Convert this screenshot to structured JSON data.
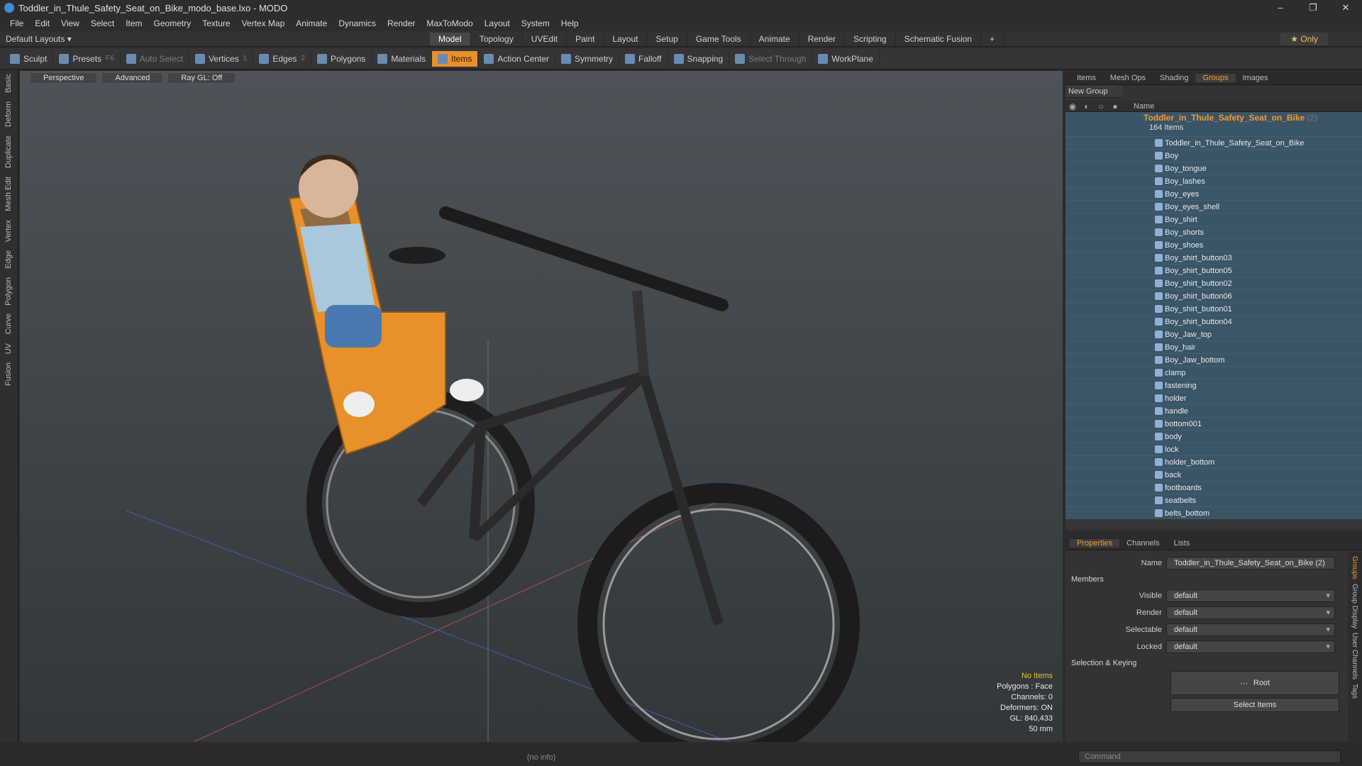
{
  "title": "Toddler_in_Thule_Safety_Seat_on_Bike_modo_base.lxo - MODO",
  "menu": [
    "File",
    "Edit",
    "View",
    "Select",
    "Item",
    "Geometry",
    "Texture",
    "Vertex Map",
    "Animate",
    "Dynamics",
    "Render",
    "MaxToModo",
    "Layout",
    "System",
    "Help"
  ],
  "layout_label": "Default Layouts ▾",
  "layout_tabs": [
    "Model",
    "Topology",
    "UVEdit",
    "Paint",
    "Layout",
    "Setup",
    "Game Tools",
    "Animate",
    "Render",
    "Scripting",
    "Schematic Fusion"
  ],
  "only_label": "★ Only",
  "toolbar": {
    "sculpt": "Sculpt",
    "presets": "Presets",
    "presets_key": "F6",
    "auto_select": "Auto Select",
    "vertices": "Vertices",
    "vertices_n": "1",
    "edges": "Edges",
    "edges_n": "2",
    "polygons": "Polygons",
    "materials": "Materials",
    "items": "Items",
    "action_center": "Action Center",
    "symmetry": "Symmetry",
    "falloff": "Falloff",
    "snapping": "Snapping",
    "select_through": "Select Through",
    "workplane": "WorkPlane"
  },
  "left_tabs": [
    "Basic",
    "Deform",
    "Duplicate",
    "Mesh Edit",
    "Vertex",
    "Edge",
    "Polygon",
    "Curve",
    "UV",
    "Fusion"
  ],
  "viewport": {
    "buttons": [
      "Perspective",
      "Advanced",
      "Ray GL: Off"
    ],
    "info": {
      "warn": "No Items",
      "polygons": "Polygons : Face",
      "channels": "Channels: 0",
      "deformers": "Deformers: ON",
      "gl": "GL: 840,433",
      "lens": "50 mm"
    }
  },
  "status_text": "(no info)",
  "groups_panel": {
    "tabs": [
      "Items",
      "Mesh Ops",
      "Shading",
      "Groups",
      "Images"
    ],
    "new_group": "New Group",
    "col_name": "Name",
    "group_name": "Toddler_in_Thule_Safety_Seat_on_Bike",
    "group_count": "(2)",
    "group_sub": "164 Items",
    "items": [
      "Toddler_in_Thule_Safety_Seat_on_Bike",
      "Boy",
      "Boy_tongue",
      "Boy_lashes",
      "Boy_eyes",
      "Boy_eyes_shell",
      "Boy_shirt",
      "Boy_shorts",
      "Boy_shoes",
      "Boy_shirt_button03",
      "Boy_shirt_button05",
      "Boy_shirt_button02",
      "Boy_shirt_button06",
      "Boy_shirt_button01",
      "Boy_shirt_button04",
      "Boy_Jaw_top",
      "Boy_hair",
      "Boy_Jaw_bottom",
      "clamp",
      "fastening",
      "holder",
      "handle",
      "bottom001",
      "body",
      "lock",
      "holder_bottom",
      "back",
      "footboards",
      "seatbelts",
      "belts_bottom"
    ]
  },
  "props": {
    "tabs": [
      "Properties",
      "Channels",
      "Lists"
    ],
    "name_label": "Name",
    "name_value": "Toddler_in_Thule_Safety_Seat_on_Bike (2)",
    "members": "Members",
    "visible": "Visible",
    "render": "Render",
    "selectable": "Selectable",
    "locked": "Locked",
    "default_val": "default",
    "sel_keying": "Selection & Keying",
    "root": "Root",
    "select_items": "Select Items"
  },
  "side_tabs": [
    "Groups",
    "Group Display",
    "User Channels",
    "Tags"
  ],
  "command_placeholder": "Command",
  "colors": {
    "accent": "#ef9c2e",
    "selection": "#3a5566",
    "seat": "#e8902a"
  }
}
